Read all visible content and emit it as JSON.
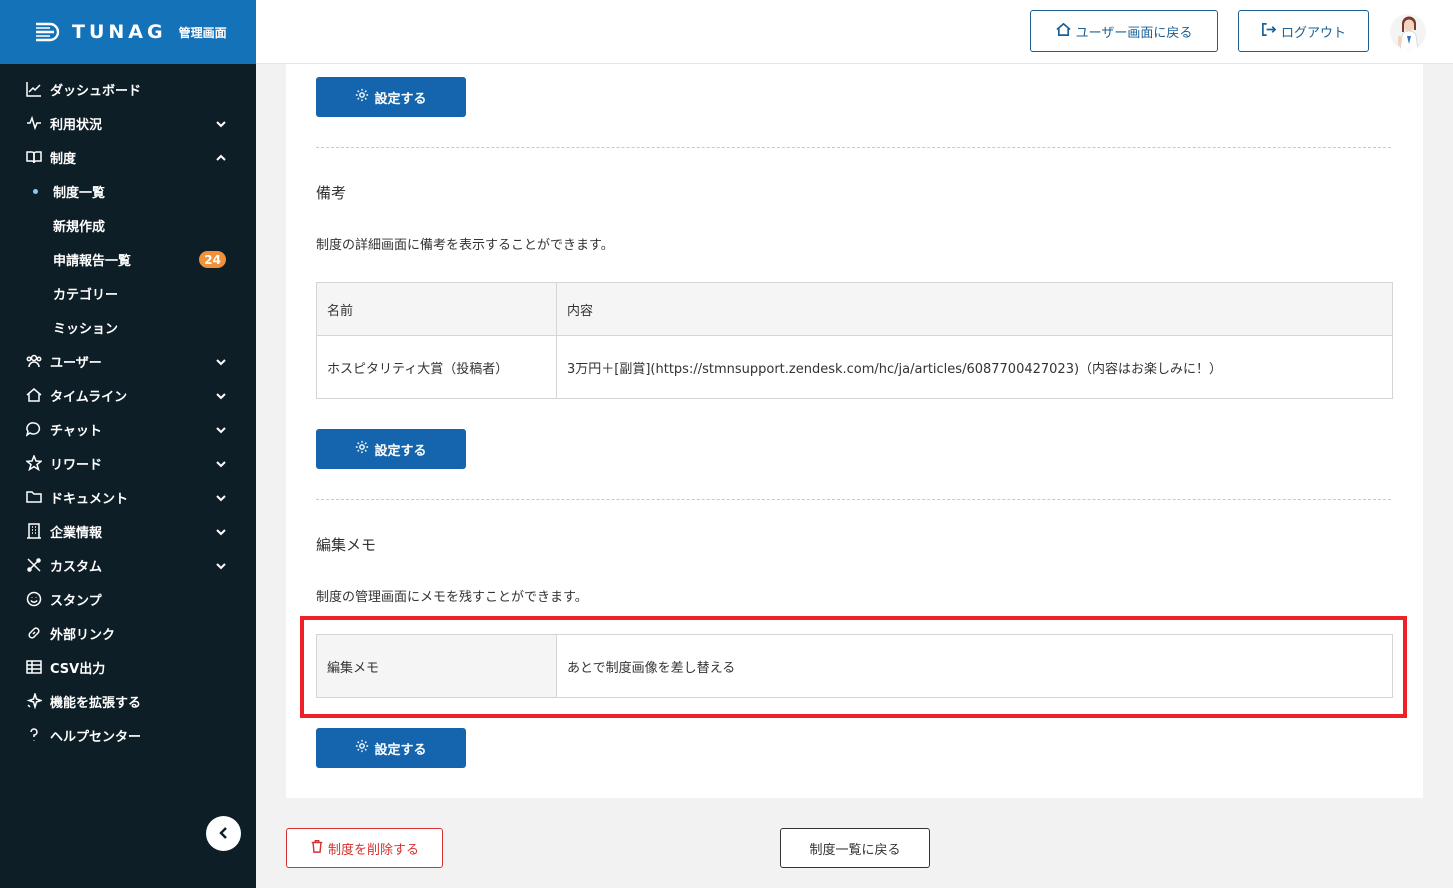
{
  "brand": {
    "name": "TUNAG",
    "subtitle": "管理画面"
  },
  "header": {
    "user_screen_label": "ユーザー画面に戻る",
    "logout_label": "ログアウト"
  },
  "sidebar": {
    "items": [
      {
        "label": "ダッシュボード",
        "icon": "chart-line-icon"
      },
      {
        "label": "利用状況",
        "icon": "pulse-icon"
      },
      {
        "label": "制度",
        "icon": "book-icon"
      },
      {
        "label": "ユーザー",
        "icon": "users-icon"
      },
      {
        "label": "タイムライン",
        "icon": "home-icon"
      },
      {
        "label": "チャット",
        "icon": "chat-icon"
      },
      {
        "label": "リワード",
        "icon": "star-icon"
      },
      {
        "label": "ドキュメント",
        "icon": "folder-icon"
      },
      {
        "label": "企業情報",
        "icon": "building-icon"
      },
      {
        "label": "カスタム",
        "icon": "tools-icon"
      },
      {
        "label": "スタンプ",
        "icon": "smile-icon"
      },
      {
        "label": "外部リンク",
        "icon": "link-icon"
      },
      {
        "label": "CSV出力",
        "icon": "table-icon"
      },
      {
        "label": "機能を拡張する",
        "icon": "sparkle-icon"
      },
      {
        "label": "ヘルプセンター",
        "icon": "question-icon"
      }
    ],
    "sub_items": [
      {
        "label": "制度一覧"
      },
      {
        "label": "新規作成"
      },
      {
        "label": "申請報告一覧",
        "badge": "24"
      },
      {
        "label": "カテゴリー"
      },
      {
        "label": "ミッション"
      }
    ]
  },
  "main": {
    "settings_label": "設定する",
    "remarks": {
      "title": "備考",
      "description": "制度の詳細画面に備考を表示することができます。",
      "col_name": "名前",
      "col_content": "内容",
      "row_name": "ホスピタリティ大賞（投稿者）",
      "row_content": "3万円＋[副賞](https://stmnsupport.zendesk.com/hc/ja/articles/6087700427023)（内容はお楽しみに！）"
    },
    "memo": {
      "title": "編集メモ",
      "description": "制度の管理画面にメモを残すことができます。",
      "label": "編集メモ",
      "value": "あとで制度画像を差し替える"
    }
  },
  "footer": {
    "delete_label": "制度を削除する",
    "back_label": "制度一覧に戻る"
  },
  "colors": {
    "primary": "#1465ad",
    "sidebar": "#0e1e26",
    "brand": "#1472b9",
    "danger": "#d63030",
    "highlight": "#ef2127",
    "badge": "#f1913a"
  }
}
